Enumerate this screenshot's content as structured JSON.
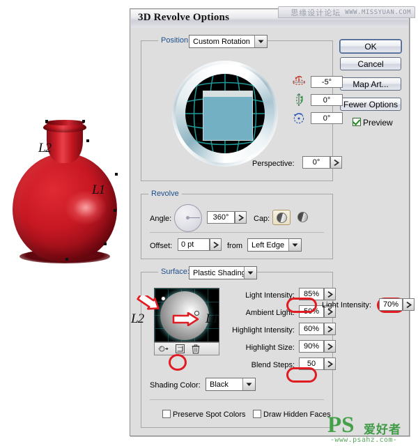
{
  "watermarks": {
    "top_cn": "思缘设计论坛",
    "top_url": "WWW.MISSYUAN.COM",
    "bottom_ps": "PS",
    "bottom_cn": "爱好者",
    "bottom_url": "-www.psahz.com-"
  },
  "artwork": {
    "name": "red-revolved-vase",
    "label_l1": "L1",
    "label_l2": "L2"
  },
  "dialog": {
    "title": "3D Revolve Options",
    "buttons": {
      "ok": "OK",
      "cancel": "Cancel",
      "map_art": "Map Art...",
      "fewer_options": "Fewer Options"
    },
    "preview_checkbox": {
      "label": "Preview",
      "checked": true
    },
    "position": {
      "group_label": "Position:",
      "preset": "Custom Rotation",
      "rotate_x": "-5°",
      "rotate_y": "0°",
      "rotate_z": "0°",
      "perspective_label": "Perspective:",
      "perspective": "0°"
    },
    "revolve": {
      "group_label": "Revolve",
      "angle_label": "Angle:",
      "angle": "360°",
      "cap_label": "Cap:",
      "cap_selected": "cap-on",
      "offset_label": "Offset:",
      "offset": "0 pt",
      "from_label": "from",
      "from": "Left Edge"
    },
    "surface": {
      "group_label": "Surface:",
      "shading": "Plastic Shading",
      "rows": [
        {
          "label": "Light Intensity:",
          "value": "85%",
          "highlighted": true
        },
        {
          "label": "Ambient Light:",
          "value": "50%",
          "highlighted": false
        },
        {
          "label": "Highlight Intensity:",
          "value": "60%",
          "highlighted": false
        },
        {
          "label": "Highlight Size:",
          "value": "90%",
          "highlighted": false
        },
        {
          "label": "Blend Steps:",
          "value": "50",
          "highlighted": true
        }
      ],
      "shading_color_label": "Shading Color:",
      "shading_color": "Black",
      "preserve_spot_colors": "Preserve Spot Colors",
      "draw_hidden_faces": "Draw Hidden Faces",
      "light_label_l1": "L1",
      "light_label_l2": "L2"
    }
  },
  "annotation": {
    "external_light_intensity_label": "Light Intensity:",
    "external_light_intensity_value": "70%",
    "accent_color": "#e01b22"
  }
}
